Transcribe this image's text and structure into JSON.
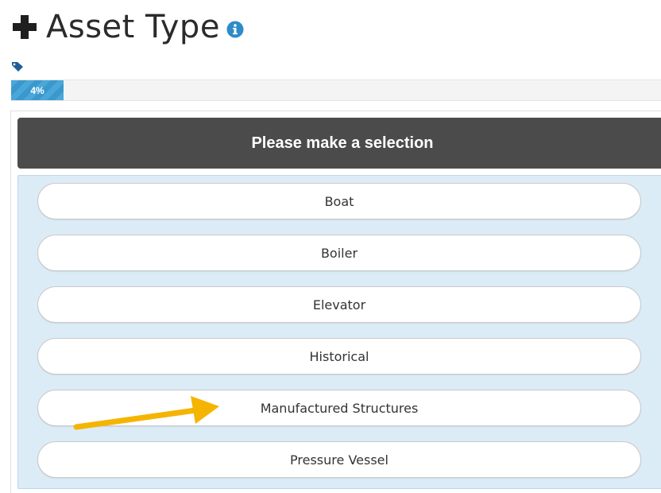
{
  "header": {
    "title": "Asset Type",
    "icons": [
      "plus-icon",
      "info-icon",
      "tag-icon"
    ]
  },
  "progress": {
    "label": "4%",
    "value": 0.04
  },
  "panel": {
    "heading": "Please make a selection",
    "options": [
      {
        "label": "Boat"
      },
      {
        "label": "Boiler"
      },
      {
        "label": "Elevator"
      },
      {
        "label": "Historical"
      },
      {
        "label": "Manufactured Structures"
      },
      {
        "label": "Pressure Vessel"
      }
    ]
  },
  "colors": {
    "accent": "#3b98cc",
    "header_bg": "#4b4b4b",
    "options_bg": "#dcecf7",
    "annotation_arrow": "#f5b400"
  }
}
